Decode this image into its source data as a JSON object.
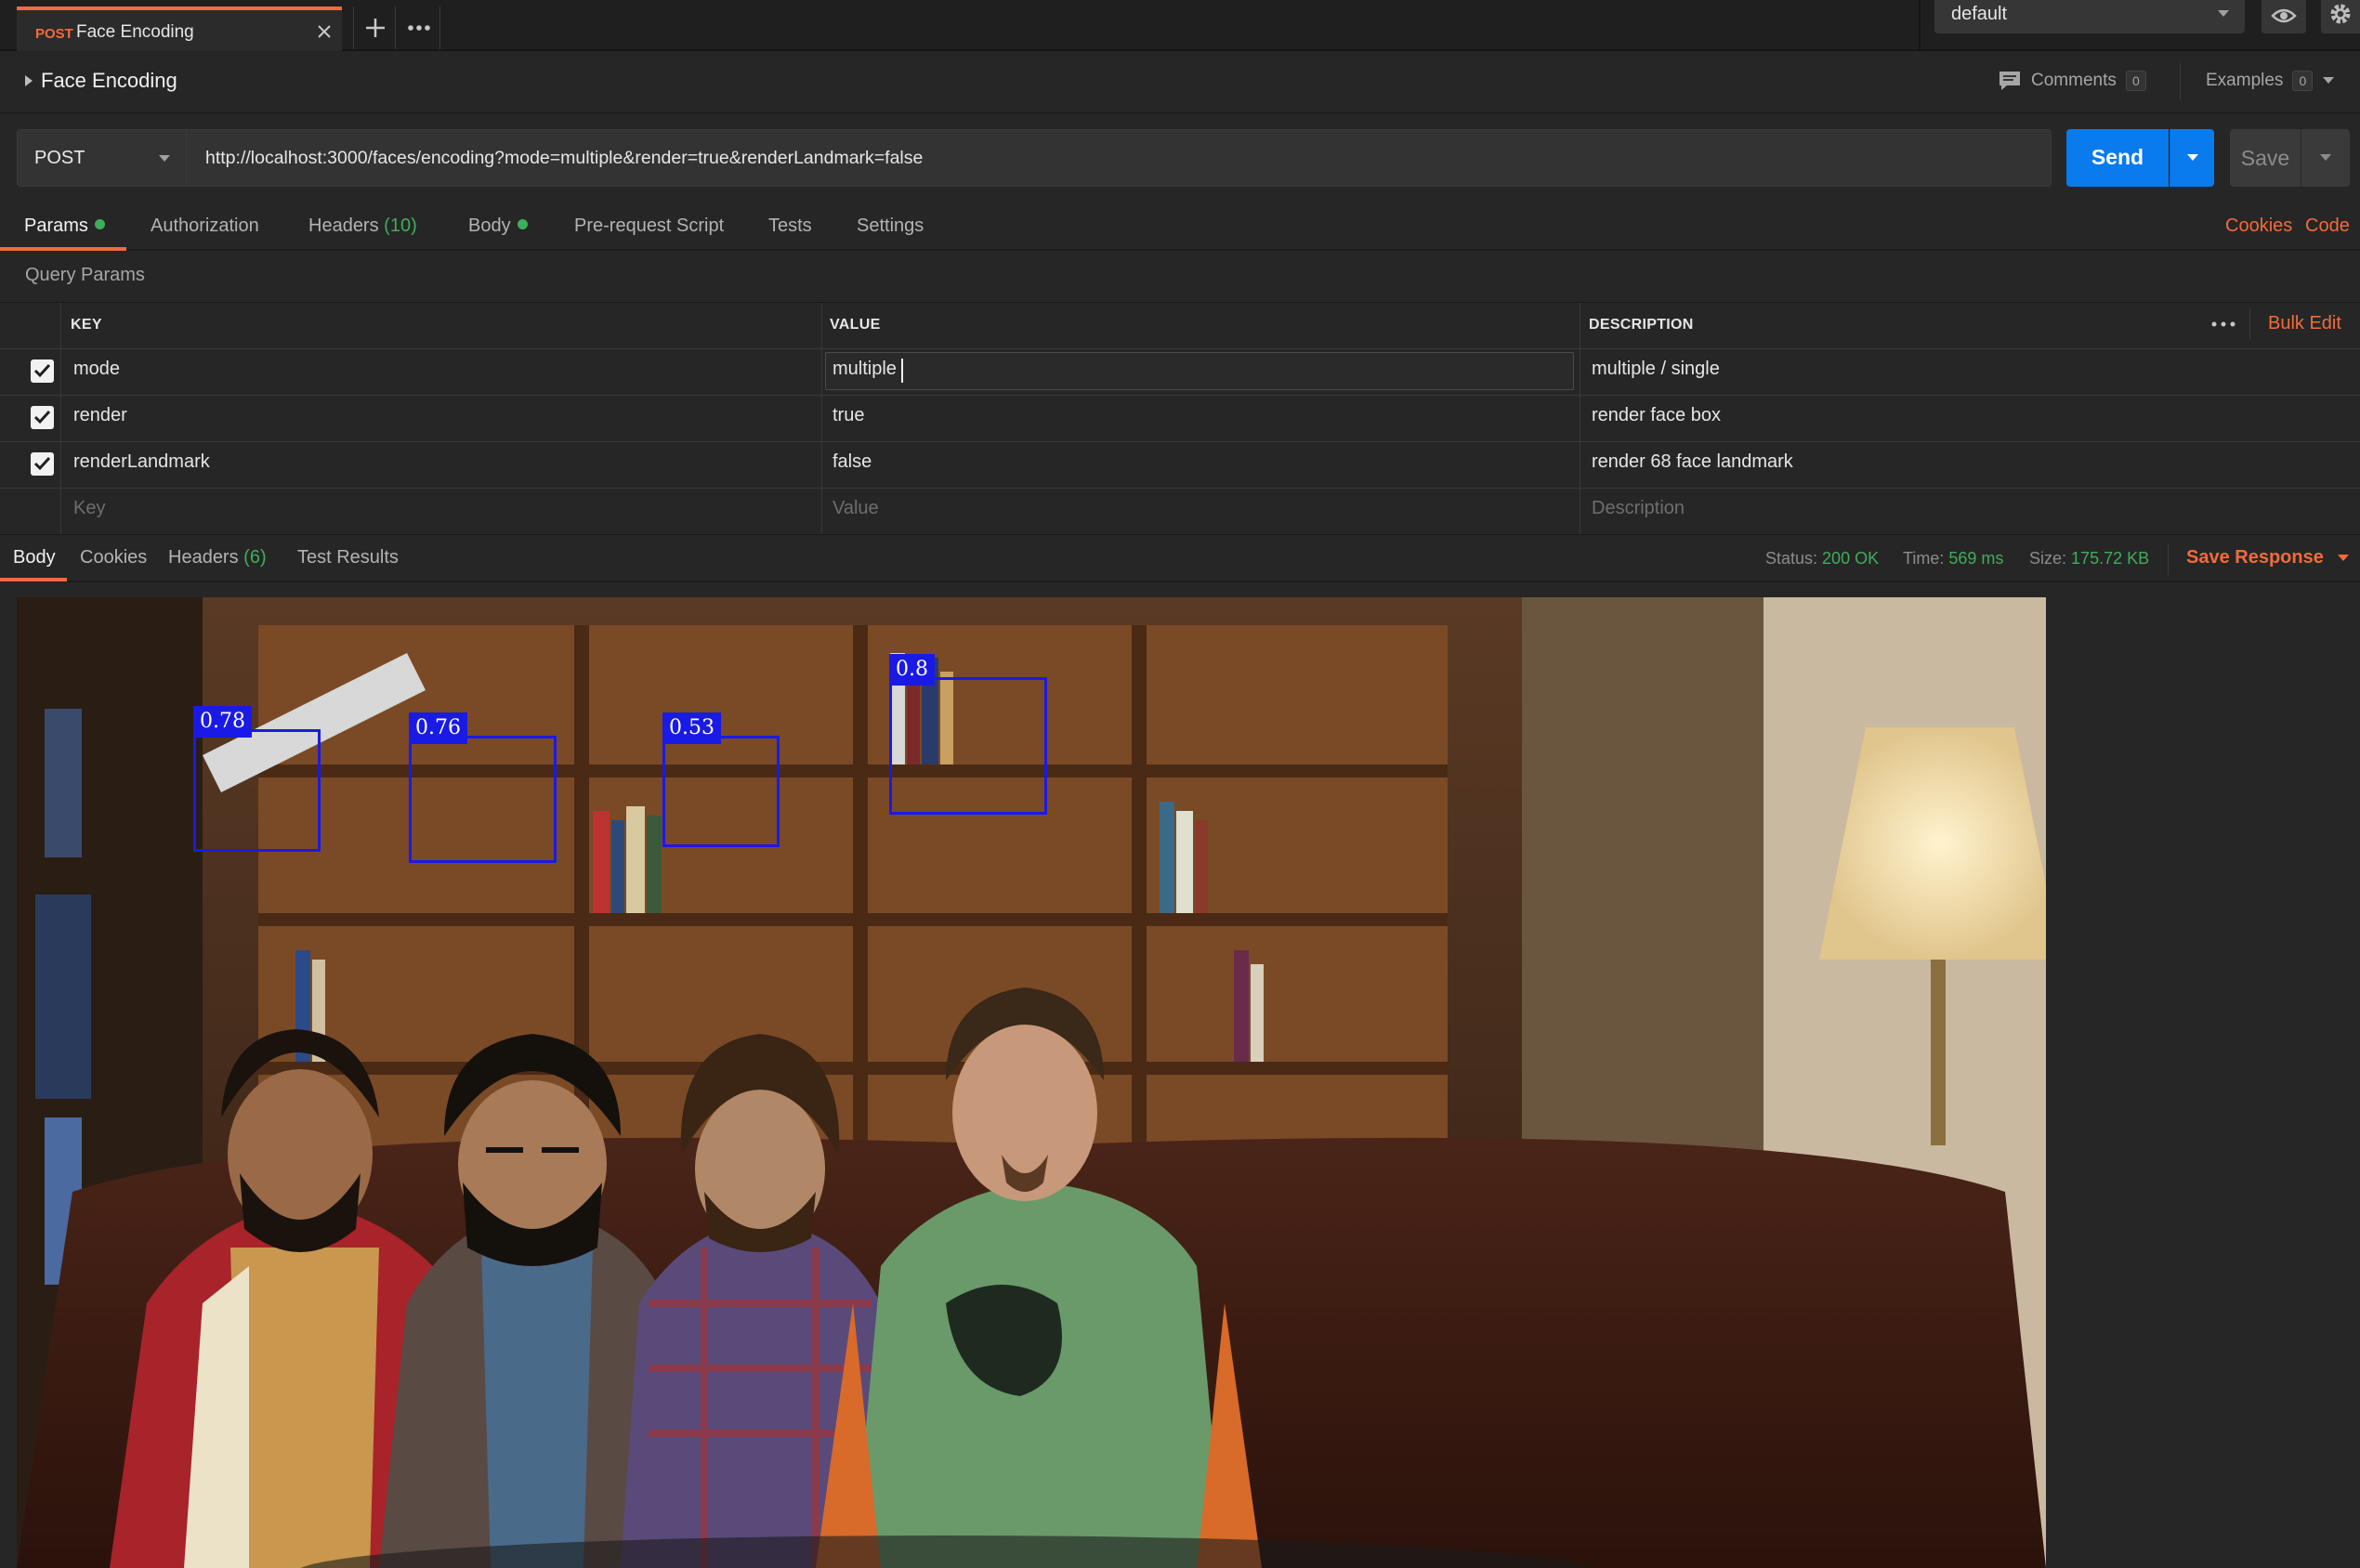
{
  "tab": {
    "method": "POST",
    "name": "Face Encoding"
  },
  "environment": {
    "selected": "default"
  },
  "request": {
    "title": "Face Encoding",
    "method": "POST",
    "url": "http://localhost:3000/faces/encoding?mode=multiple&render=true&renderLandmark=false"
  },
  "header_right": {
    "comments_label": "Comments",
    "comments_count": "0",
    "examples_label": "Examples",
    "examples_count": "0"
  },
  "buttons": {
    "send": "Send",
    "save": "Save"
  },
  "request_tabs": {
    "params": "Params",
    "authorization": "Authorization",
    "headers": "Headers",
    "headers_count": "(10)",
    "body": "Body",
    "pre_request": "Pre-request Script",
    "tests": "Tests",
    "settings": "Settings",
    "cookies": "Cookies",
    "code": "Code"
  },
  "query_params": {
    "title": "Query Params",
    "columns": {
      "key": "KEY",
      "value": "VALUE",
      "description": "DESCRIPTION"
    },
    "bulk_edit": "Bulk Edit",
    "rows": [
      {
        "checked": true,
        "key": "mode",
        "value": "multiple",
        "description": "multiple / single"
      },
      {
        "checked": true,
        "key": "render",
        "value": "true",
        "description": "render face box"
      },
      {
        "checked": true,
        "key": "renderLandmark",
        "value": "false",
        "description": "render 68 face landmark"
      }
    ],
    "placeholders": {
      "key": "Key",
      "value": "Value",
      "description": "Description"
    }
  },
  "response": {
    "tabs": {
      "body": "Body",
      "cookies": "Cookies",
      "headers": "Headers",
      "headers_count": "(6)",
      "test_results": "Test Results"
    },
    "status_label": "Status:",
    "status": "200 OK",
    "time_label": "Time:",
    "time": "569 ms",
    "size_label": "Size:",
    "size": "175.72 KB",
    "save_response": "Save Response"
  },
  "detections": [
    {
      "label": "0.78"
    },
    {
      "label": "0.76"
    },
    {
      "label": "0.53"
    },
    {
      "label": "0.8"
    }
  ],
  "colors": {
    "accent": "#f26b3a",
    "send": "#097bed",
    "success": "#3fae5a",
    "face_box": "#1a1ae6"
  }
}
